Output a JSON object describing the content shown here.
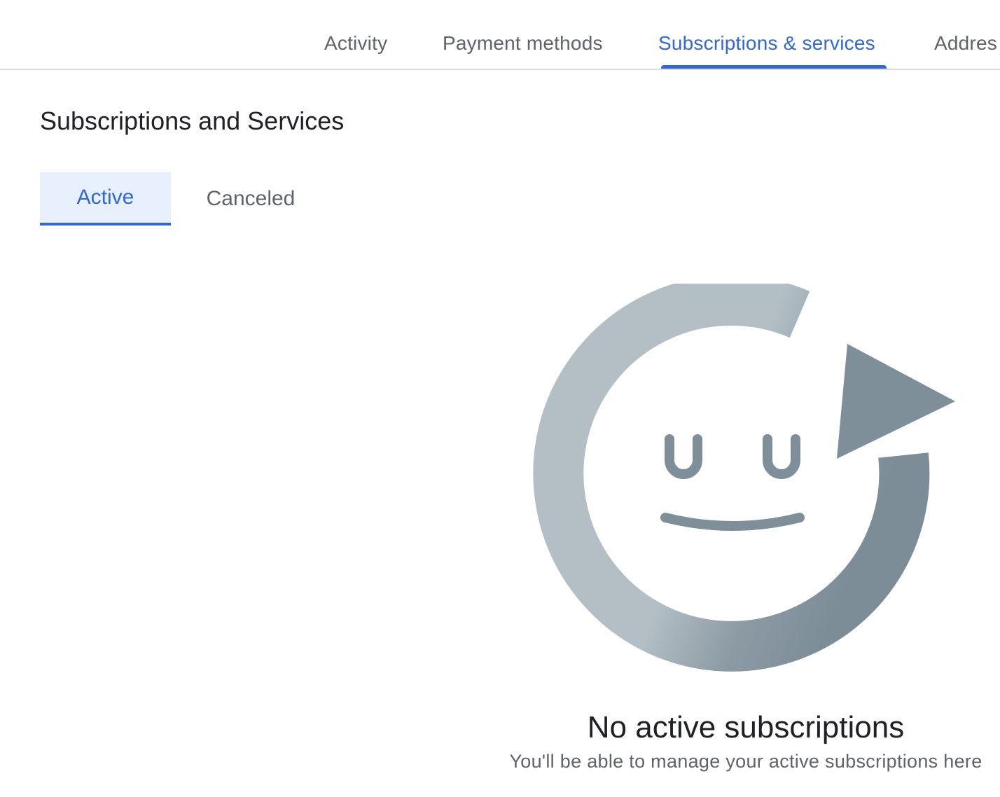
{
  "nav": {
    "tabs": [
      {
        "label": "Activity"
      },
      {
        "label": "Payment methods"
      },
      {
        "label": "Subscriptions & services"
      },
      {
        "label": "Addres"
      }
    ],
    "selected": "Subscriptions & services"
  },
  "page": {
    "title": "Subscriptions and Services"
  },
  "subtabs": {
    "active_label": "Active",
    "canceled_label": "Canceled",
    "selected": "Active"
  },
  "empty_state": {
    "illustration": "renewal-arrow-smiley-icon",
    "title": "No active subscriptions",
    "subtitle": "You'll be able to manage your active subscriptions here"
  },
  "colors": {
    "accent": "#3367d6",
    "active_tab_bg": "#e8f0fe",
    "illustration_light": "#b3bec5",
    "illustration_dark": "#7f8f99"
  }
}
